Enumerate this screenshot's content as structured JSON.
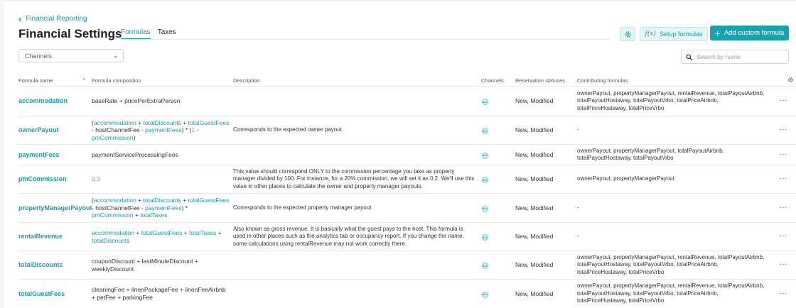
{
  "breadcrumb": {
    "label": "Financial Reporting"
  },
  "page": {
    "title": "Financial Settings"
  },
  "tabs": [
    {
      "label": "Formulas"
    },
    {
      "label": "Taxes"
    }
  ],
  "toolbar": {
    "setup_label": "Setup formulas",
    "fx_label": "f(x)",
    "add_label": "Add custom formula"
  },
  "filter": {
    "channels_value": "Channels"
  },
  "search": {
    "placeholder": "Search by name"
  },
  "columns": {
    "name": "Formula name",
    "composition": "Formula composition",
    "description": "Description",
    "channels": "Channels",
    "statuses": "Reservation statuses",
    "contributing": "Contributing formulas"
  },
  "rows": [
    {
      "name": "accommodation",
      "composition": [
        {
          "t": "baseRate + pricePerExtraPerson",
          "k": "plain"
        }
      ],
      "description": "",
      "channel": "ALL",
      "status": "New, Modified",
      "contributing": "ownerPayout, propertyManagerPayout, rentalRevenue, totalPayoutAirbnb, totalPayoutHostaway, totalPayoutVrbo, totalPriceAirbnb, totalPriceHostaway, totalPriceVrbo"
    },
    {
      "name": "ownerPayout",
      "composition": [
        {
          "t": "(",
          "k": "plain"
        },
        {
          "t": "accommodation",
          "k": "link"
        },
        {
          "t": " + ",
          "k": "plain"
        },
        {
          "t": "totalDiscounts",
          "k": "link"
        },
        {
          "t": " + ",
          "k": "plain"
        },
        {
          "t": "totalGuestFees",
          "k": "link"
        },
        {
          "t": " - hostChannelFee - ",
          "k": "plain"
        },
        {
          "t": "paymentFees",
          "k": "link"
        },
        {
          "t": ")",
          "k": "plain"
        },
        {
          "t": " * (",
          "k": "plain"
        },
        {
          "t": "1",
          "k": "num"
        },
        {
          "t": " - ",
          "k": "plain"
        },
        {
          "t": "pmCommission",
          "k": "link"
        },
        {
          "t": ")",
          "k": "plain"
        }
      ],
      "description": "Corresponds to the expected owner payout",
      "channel": "ALL",
      "status": "New, Modified",
      "contributing": "-"
    },
    {
      "name": "paymentFees",
      "composition": [
        {
          "t": "paymentServiceProcessingFees",
          "k": "plain"
        }
      ],
      "description": "",
      "channel": "ALL",
      "status": "New, Modified",
      "contributing": "ownerPayout, propertyManagerPayout, totalPayoutAirbnb, totalPayoutHostaway, totalPayoutVrbo"
    },
    {
      "name": "pmCommission",
      "composition": [
        {
          "t": "0.3",
          "k": "num"
        }
      ],
      "description": "This value should correspond ONLY to the commission percentage you take as property manager divided by 100. For instance, for a 20% commission, we will set it as 0.2. We'll use this value in other places to calculate the owner and property manager payouts.",
      "channel": "ALL",
      "status": "New, Modified",
      "contributing": "ownerPayout, propertyManagerPayout"
    },
    {
      "name": "propertyManagerPayout",
      "composition": [
        {
          "t": "(",
          "k": "plain"
        },
        {
          "t": "accommodation",
          "k": "link"
        },
        {
          "t": " + ",
          "k": "plain"
        },
        {
          "t": "totalDiscounts",
          "k": "link"
        },
        {
          "t": " + ",
          "k": "plain"
        },
        {
          "t": "totalGuestFees",
          "k": "link"
        },
        {
          "t": " - hostChannelFee - ",
          "k": "plain"
        },
        {
          "t": "paymentFees",
          "k": "link"
        },
        {
          "t": ")",
          "k": "plain"
        },
        {
          "t": " * ",
          "k": "plain"
        },
        {
          "t": "pmCommission",
          "k": "link"
        },
        {
          "t": " + ",
          "k": "plain"
        },
        {
          "t": "totalTaxes",
          "k": "link"
        }
      ],
      "description": "Corresponds to the expected property manager payout",
      "channel": "ALL",
      "status": "New, Modified",
      "contributing": "-"
    },
    {
      "name": "rentalRevenue",
      "composition": [
        {
          "t": "accommodation",
          "k": "link"
        },
        {
          "t": " + ",
          "k": "plain"
        },
        {
          "t": "totalGuestFees",
          "k": "link"
        },
        {
          "t": " + ",
          "k": "plain"
        },
        {
          "t": "totalTaxes",
          "k": "link"
        },
        {
          "t": " + ",
          "k": "plain"
        },
        {
          "t": "totalDiscounts",
          "k": "link"
        }
      ],
      "description": "Also known as gross revenue. It is basically what the guest pays to the host. This formula is used in other places such as the analytics tab or occupancy report. If you change the name, some calculations using rentalRevenue may not work correctly there.",
      "channel": "ALL",
      "status": "New, Modified",
      "contributing": "-"
    },
    {
      "name": "totalDiscounts",
      "composition": [
        {
          "t": "couponDiscount + lastMinuteDiscount + weeklyDiscount",
          "k": "plain"
        }
      ],
      "description": "",
      "channel": "ALL",
      "status": "New, Modified",
      "contributing": "ownerPayout, propertyManagerPayout, rentalRevenue, totalPayoutAirbnb, totalPayoutHostaway, totalPayoutVrbo, totalPriceAirbnb, totalPriceHostaway, totalPriceVrbo"
    },
    {
      "name": "totalGuestFees",
      "composition": [
        {
          "t": "cleaningFee + linenPackageFee + linenFeeAirbnb + petFee + parkingFee",
          "k": "plain"
        }
      ],
      "description": "",
      "channel": "ALL",
      "status": "New, Modified",
      "contributing": "ownerPayout, propertyManagerPayout, rentalRevenue, totalPayoutAirbnb, totalPayoutHostaway, totalPayoutVrbo, totalPriceAirbnb, totalPriceHostaway, totalPriceVrbo"
    }
  ],
  "row_menu_label": "···",
  "icons": {
    "back": "chevron-left-icon",
    "gear": "gear-icon",
    "fx": "function-icon",
    "plus": "plus-icon",
    "caret": "chevron-down-icon",
    "search": "search-icon",
    "sort": "sort-asc-icon",
    "channel": "all-channels-icon",
    "menu": "more-horizontal-icon"
  },
  "colors": {
    "accent": "#17a3ac",
    "link": "#1a9aa6",
    "number": "#e8823a"
  }
}
